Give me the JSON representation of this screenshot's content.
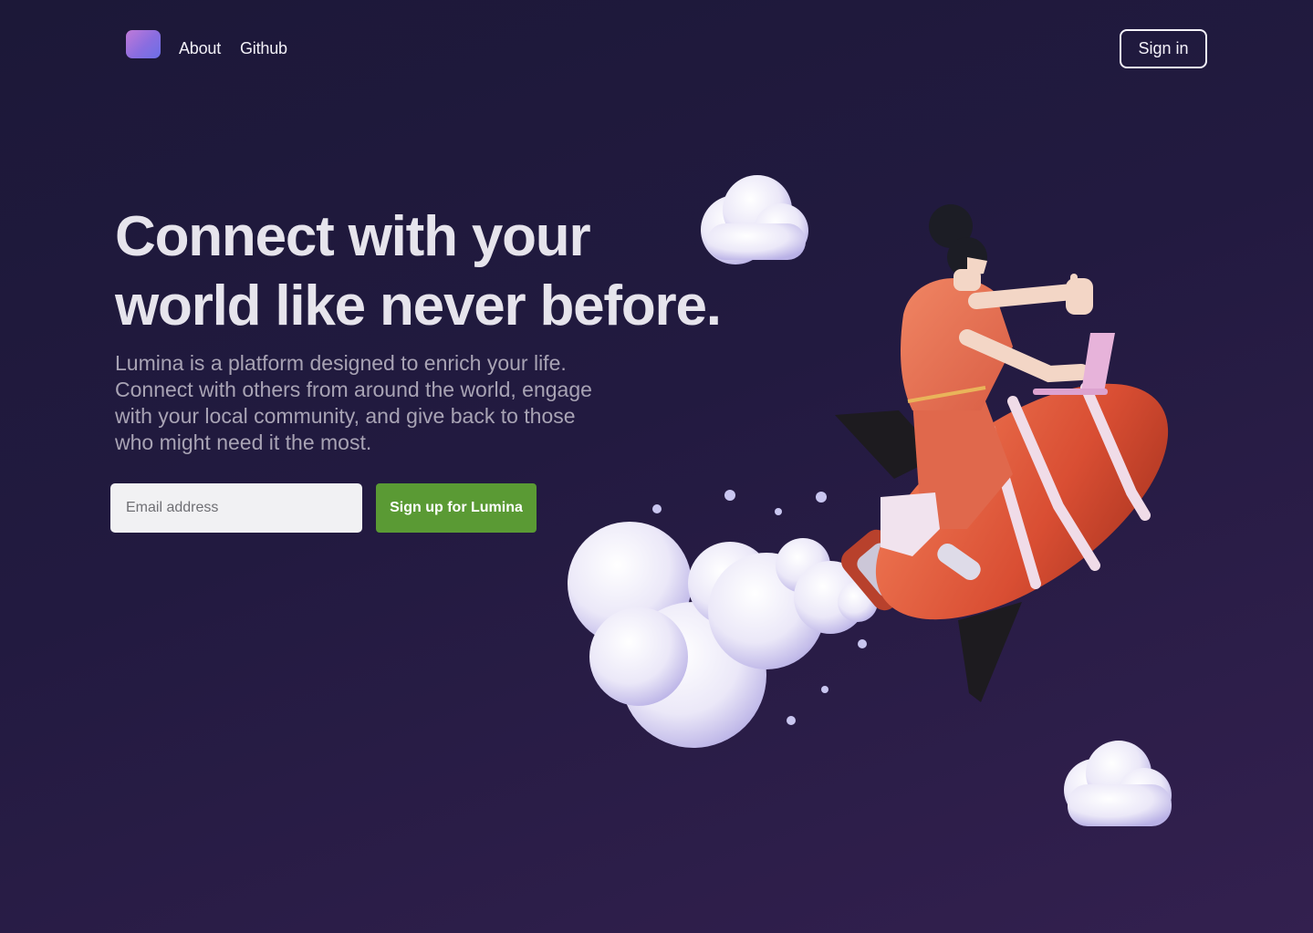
{
  "nav": {
    "links": [
      {
        "label": "About"
      },
      {
        "label": "Github"
      }
    ],
    "signin_label": "Sign in"
  },
  "hero": {
    "headline_line1": "Connect with your",
    "headline_line2": "world like never before.",
    "description": "Lumina is a platform designed to enrich your life. Connect with others from around the world, engage with your local community, and give back to those who might need it the most.",
    "email_placeholder": "Email address",
    "signup_label": "Sign up for Lumina"
  },
  "colors": {
    "background": "#221a40",
    "accent_button": "#5a9a34",
    "logo_gradient_start": "#c07ad8",
    "logo_gradient_end": "#6b6fe6"
  },
  "icons": {
    "logo": "brand-logo-icon",
    "illustration": "rocket-rider-illustration"
  }
}
